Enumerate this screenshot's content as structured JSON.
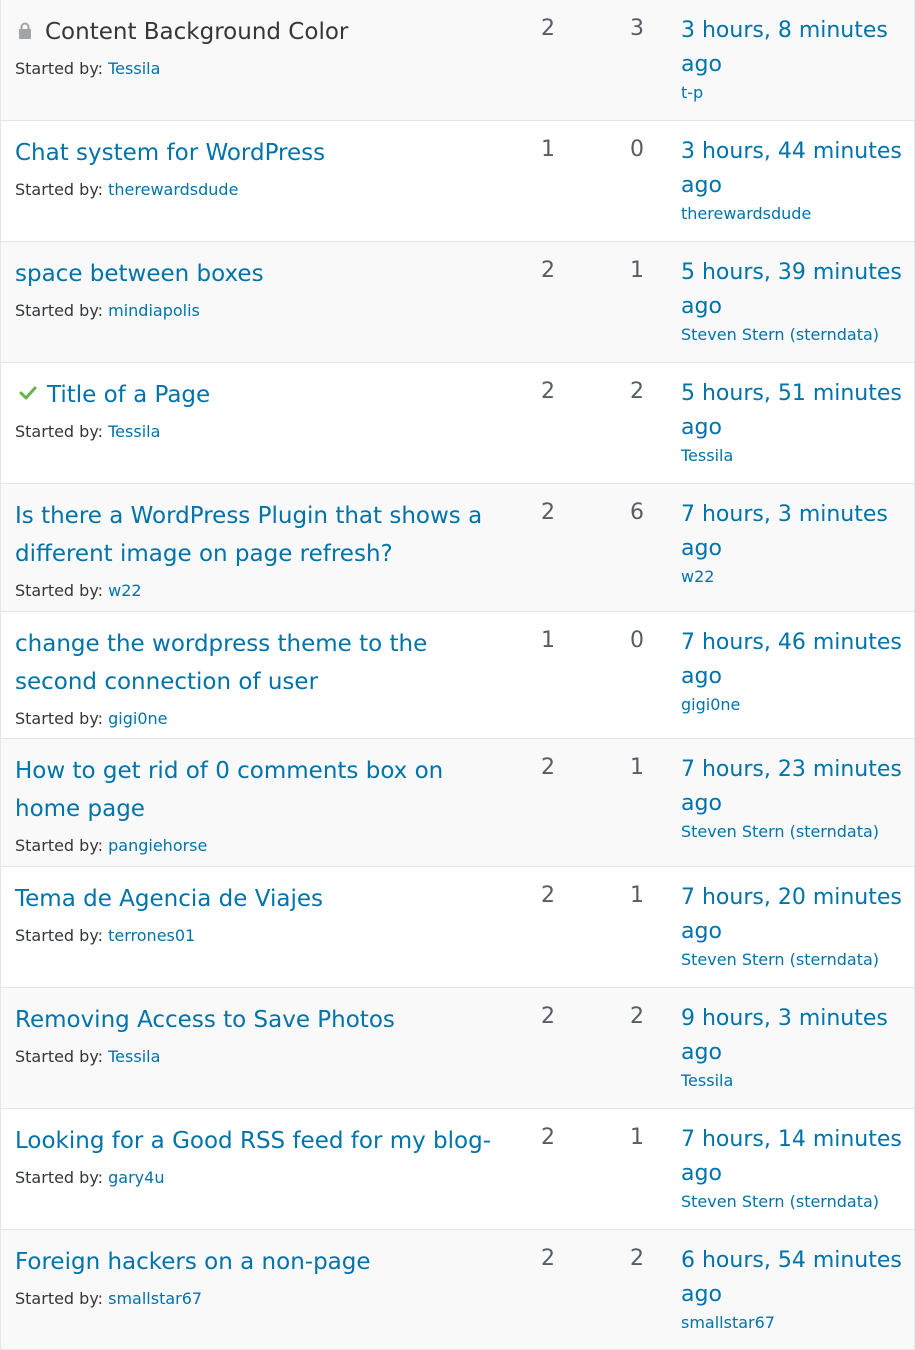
{
  "started_by_label": "Started by:",
  "topics": [
    {
      "title": "Content Background Color",
      "status": "closed",
      "author": "Tessila",
      "voices": "2",
      "posts": "3",
      "freshness": "3 hours, 8 minutes ago",
      "last_by": "t-p"
    },
    {
      "title": "Chat system for WordPress",
      "status": "",
      "author": "therewardsdude",
      "voices": "1",
      "posts": "0",
      "freshness": "3 hours, 44 minutes ago",
      "last_by": "therewardsdude"
    },
    {
      "title": "space between boxes",
      "status": "",
      "author": "mindiapolis",
      "voices": "2",
      "posts": "1",
      "freshness": "5 hours, 39 minutes ago",
      "last_by": "Steven Stern (sterndata)"
    },
    {
      "title": "Title of a Page",
      "status": "resolved",
      "author": "Tessila",
      "voices": "2",
      "posts": "2",
      "freshness": "5 hours, 51 minutes ago",
      "last_by": "Tessila"
    },
    {
      "title": "Is there a WordPress Plugin that shows a different image on page refresh?",
      "status": "",
      "author": "w22",
      "voices": "2",
      "posts": "6",
      "freshness": "7 hours, 3 minutes ago",
      "last_by": "w22"
    },
    {
      "title": "change the wordpress theme to the second connection of user",
      "status": "",
      "author": "gigi0ne",
      "voices": "1",
      "posts": "0",
      "freshness": "7 hours, 46 minutes ago",
      "last_by": "gigi0ne"
    },
    {
      "title": "How to get rid of 0 comments box on home page",
      "status": "",
      "author": "pangiehorse",
      "voices": "2",
      "posts": "1",
      "freshness": "7 hours, 23 minutes ago",
      "last_by": "Steven Stern (sterndata)"
    },
    {
      "title": "Tema de Agencia de Viajes",
      "status": "",
      "author": "terrones01",
      "voices": "2",
      "posts": "1",
      "freshness": "7 hours, 20 minutes ago",
      "last_by": "Steven Stern (sterndata)"
    },
    {
      "title": "Removing Access to Save Photos",
      "status": "",
      "author": "Tessila",
      "voices": "2",
      "posts": "2",
      "freshness": "9 hours, 3 minutes ago",
      "last_by": "Tessila"
    },
    {
      "title": "Looking for a Good RSS feed for my blog-",
      "status": "",
      "author": "gary4u",
      "voices": "2",
      "posts": "1",
      "freshness": "7 hours, 14 minutes ago",
      "last_by": "Steven Stern (sterndata)"
    },
    {
      "title": "Foreign hackers on a non-page",
      "status": "",
      "author": "smallstar67",
      "voices": "2",
      "posts": "2",
      "freshness": "6 hours, 54 minutes ago",
      "last_by": "smallstar67"
    }
  ],
  "colors": {
    "link": "#0073aa",
    "text": "#32373c",
    "resolved_check": "#64b450",
    "lock_icon": "#a0a5aa",
    "row_odd": "#f9f9f9",
    "row_even": "#ffffff"
  },
  "icons": {
    "closed": "lock-icon",
    "resolved": "checkmark-icon"
  }
}
